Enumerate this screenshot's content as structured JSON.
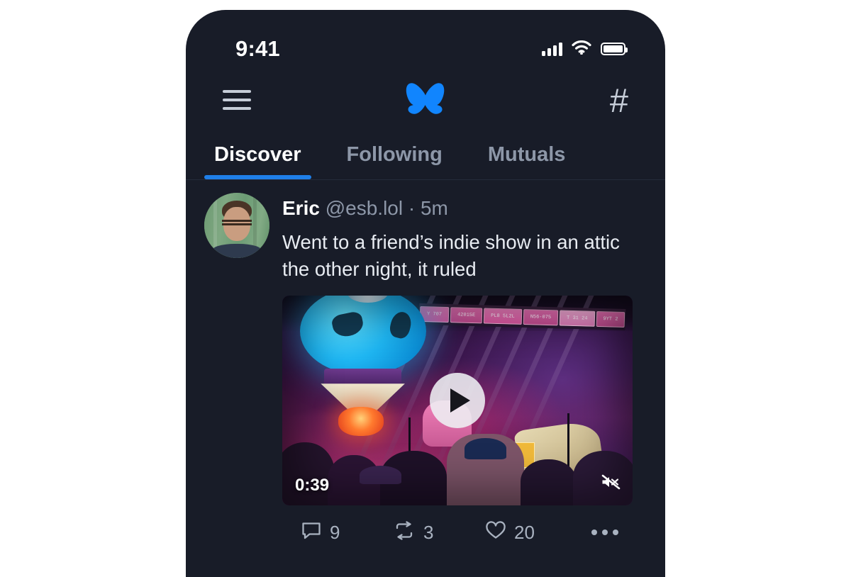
{
  "status_bar": {
    "time": "9:41",
    "cellular_icon": "cellular-signal-icon",
    "wifi_icon": "wifi-icon",
    "battery_icon": "battery-icon"
  },
  "nav": {
    "menu_icon": "hamburger-menu-icon",
    "logo_icon": "bluesky-butterfly-logo",
    "hash_label": "#",
    "hash_icon": "hashtag-icon"
  },
  "tabs": [
    {
      "label": "Discover",
      "active": true
    },
    {
      "label": "Following",
      "active": false
    },
    {
      "label": "Mutuals",
      "active": false
    }
  ],
  "post": {
    "avatar_name": "user-avatar",
    "author": "Eric",
    "handle": "@esb.lol",
    "separator": "·",
    "timestamp": "5m",
    "text": "Went to a friend’s indie show in an attic the other night, it ruled",
    "video": {
      "duration": "0:39",
      "play_icon": "play-icon",
      "mute_icon": "muted-speaker-icon",
      "license_plates": [
        "Y 707",
        "42015E",
        "PL8 5L2L",
        "N56-075",
        "T 31 24",
        "9YT 2"
      ]
    },
    "actions": [
      {
        "name": "reply",
        "icon": "comment-icon",
        "count": "9"
      },
      {
        "name": "repost",
        "icon": "repost-icon",
        "count": "3"
      },
      {
        "name": "like",
        "icon": "heart-icon",
        "count": "20"
      }
    ],
    "more_icon": "more-options-icon"
  },
  "colors": {
    "background": "#181c28",
    "accent": "#1f7fe8",
    "logo": "#1185fe",
    "text_primary": "#ffffff",
    "text_secondary": "#8d97a8",
    "page_background": "#ffffff"
  }
}
